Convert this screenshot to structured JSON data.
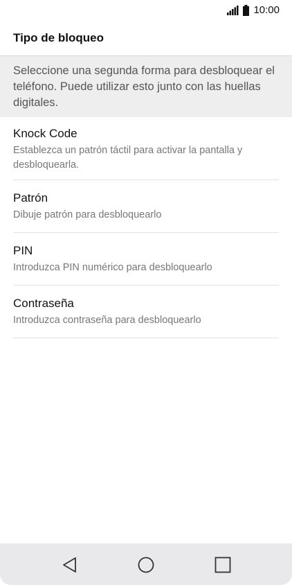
{
  "status_bar": {
    "time": "10:00",
    "icons": [
      "signal-icon",
      "battery-icon"
    ]
  },
  "app_bar": {
    "title": "Tipo de bloqueo"
  },
  "description": "Seleccione una segunda forma para desbloquear el teléfono. Puede utilizar esto junto con las huellas digitales.",
  "lock_options": [
    {
      "title": "Knock Code",
      "subtitle": "Establezca un patrón táctil para activar la pantalla y desbloquearla."
    },
    {
      "title": "Patrón",
      "subtitle": "Dibuje patrón para desbloquearlo"
    },
    {
      "title": "PIN",
      "subtitle": "Introduzca PIN numérico para desbloquearlo"
    },
    {
      "title": "Contraseña",
      "subtitle": "Introduzca contraseña para desbloquearlo"
    }
  ],
  "nav_bar": {
    "buttons": [
      "back-icon",
      "home-icon",
      "recents-icon"
    ]
  },
  "colors": {
    "description_bg": "#eeeeee",
    "nav_bg": "#e9e9ec",
    "divider": "#e2e2e2"
  }
}
